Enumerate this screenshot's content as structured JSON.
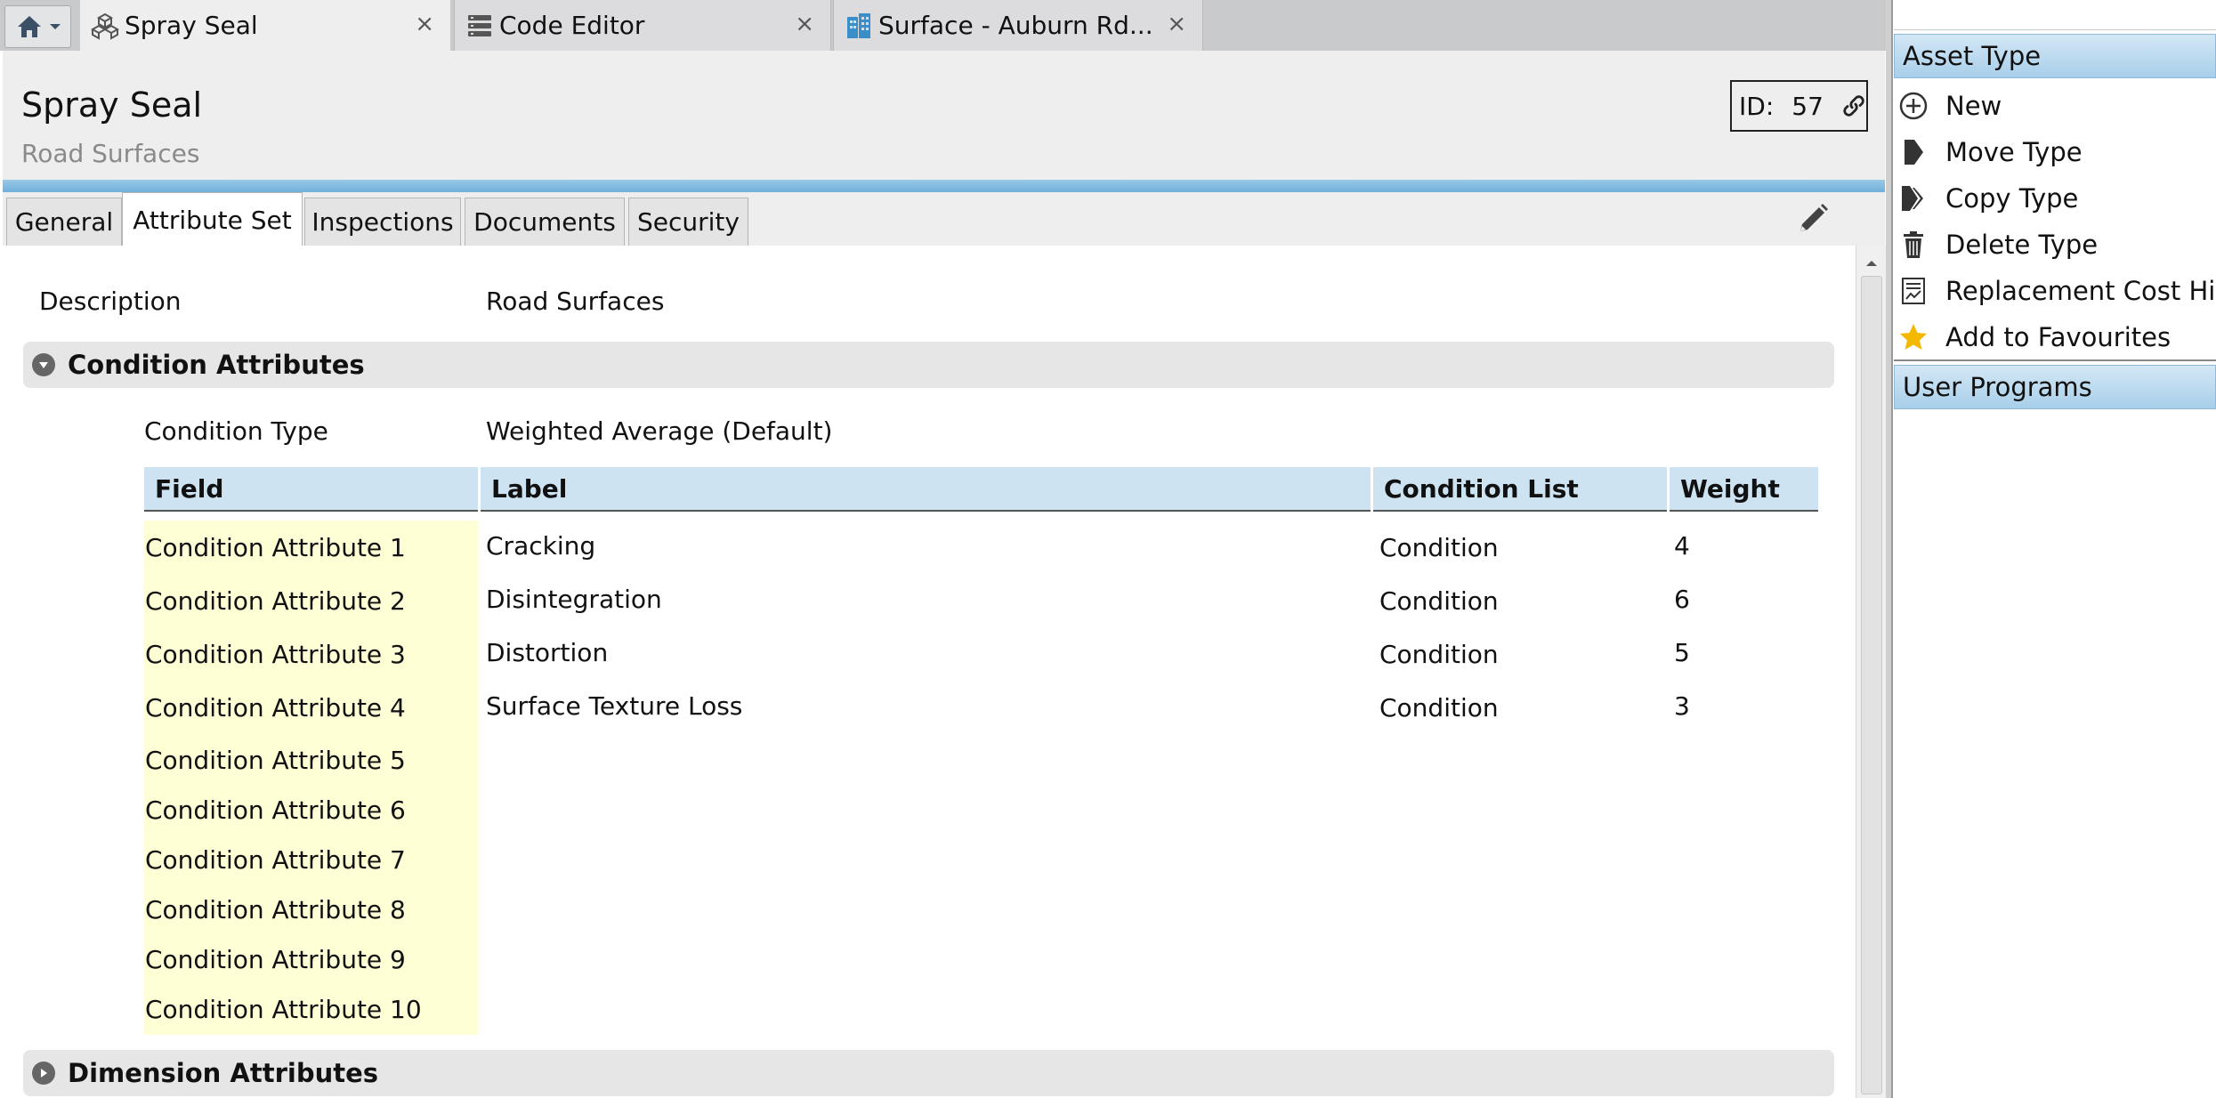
{
  "tabs": {
    "home_icon": "home-icon",
    "items": [
      {
        "label": "Spray Seal",
        "icon": "asset-type-icon",
        "active": true
      },
      {
        "label": "Code Editor",
        "icon": "code-editor-icon",
        "active": false
      },
      {
        "label": "Surface - Auburn Rd...",
        "icon": "building-icon",
        "active": false
      }
    ],
    "close_glyph": "×"
  },
  "header": {
    "title": "Spray Seal",
    "subtitle": "Road Surfaces",
    "id_label": "ID:",
    "id_value": "57"
  },
  "content_tabs": [
    "General",
    "Attribute Set",
    "Inspections",
    "Documents",
    "Security"
  ],
  "active_content_tab": "Attribute Set",
  "attribute_set": {
    "description_label": "Description",
    "description_value": "Road Surfaces",
    "condition_section": {
      "title": "Condition Attributes",
      "condition_type_label": "Condition Type",
      "condition_type_value": "Weighted Average (Default)",
      "columns": [
        "Field",
        "Label",
        "Condition List",
        "Weight"
      ],
      "rows": [
        {
          "field": "Condition Attribute 1",
          "label": "Cracking",
          "list": "Condition",
          "weight": "4"
        },
        {
          "field": "Condition Attribute 2",
          "label": "Disintegration",
          "list": "Condition",
          "weight": "6"
        },
        {
          "field": "Condition Attribute 3",
          "label": "Distortion",
          "list": "Condition",
          "weight": "5"
        },
        {
          "field": "Condition Attribute 4",
          "label": "Surface Texture Loss",
          "list": "Condition",
          "weight": "3"
        },
        {
          "field": "Condition Attribute 5",
          "label": "",
          "list": "",
          "weight": ""
        },
        {
          "field": "Condition Attribute 6",
          "label": "",
          "list": "",
          "weight": ""
        },
        {
          "field": "Condition Attribute 7",
          "label": "",
          "list": "",
          "weight": ""
        },
        {
          "field": "Condition Attribute 8",
          "label": "",
          "list": "",
          "weight": ""
        },
        {
          "field": "Condition Attribute 9",
          "label": "",
          "list": "",
          "weight": ""
        },
        {
          "field": "Condition Attribute 10",
          "label": "",
          "list": "",
          "weight": ""
        }
      ]
    },
    "dimension_section": {
      "title": "Dimension Attributes"
    }
  },
  "right_panel": {
    "asset_type_header": "Asset Type",
    "items": [
      {
        "label": "New",
        "icon": "plus-circle-icon"
      },
      {
        "label": "Move Type",
        "icon": "move-icon"
      },
      {
        "label": "Copy Type",
        "icon": "copy-icon"
      },
      {
        "label": "Delete Type",
        "icon": "trash-icon"
      },
      {
        "label": "Replacement Cost Hist",
        "icon": "cost-history-icon"
      },
      {
        "label": "Add to Favourites",
        "icon": "star-icon"
      }
    ],
    "user_programs_header": "User Programs"
  },
  "colors": {
    "accent_blue": "#6fb0db",
    "field_highlight": "#ffffd6",
    "table_header": "#cde3f1",
    "star": "#f5b800"
  }
}
